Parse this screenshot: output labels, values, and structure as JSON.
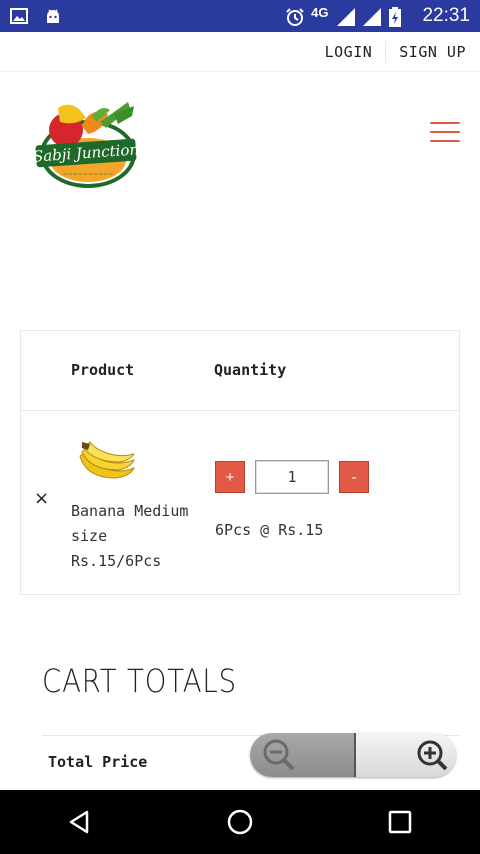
{
  "status_bar": {
    "time": "22:31",
    "network": "4G",
    "icons": [
      "gallery-icon",
      "android-icon",
      "alarm-icon",
      "signal-icon",
      "battery-icon"
    ]
  },
  "top_links": {
    "login": "LOGIN",
    "signup": "SIGN UP"
  },
  "header": {
    "logo_text": "Sabji Junction",
    "accent_color": "#e05a47"
  },
  "cart": {
    "headers": {
      "product": "Product",
      "quantity": "Quantity"
    },
    "items": [
      {
        "name_line1": "Banana Medium",
        "name_line2": "size",
        "name_line3": "Rs.15/6Pcs",
        "quantity": "1",
        "unit_price": "6Pcs @ Rs.15",
        "plus_label": "+",
        "minus_label": "-",
        "remove_label": "×"
      }
    ]
  },
  "totals": {
    "title": "CART TOTALS",
    "total_price_label": "Total Price"
  }
}
